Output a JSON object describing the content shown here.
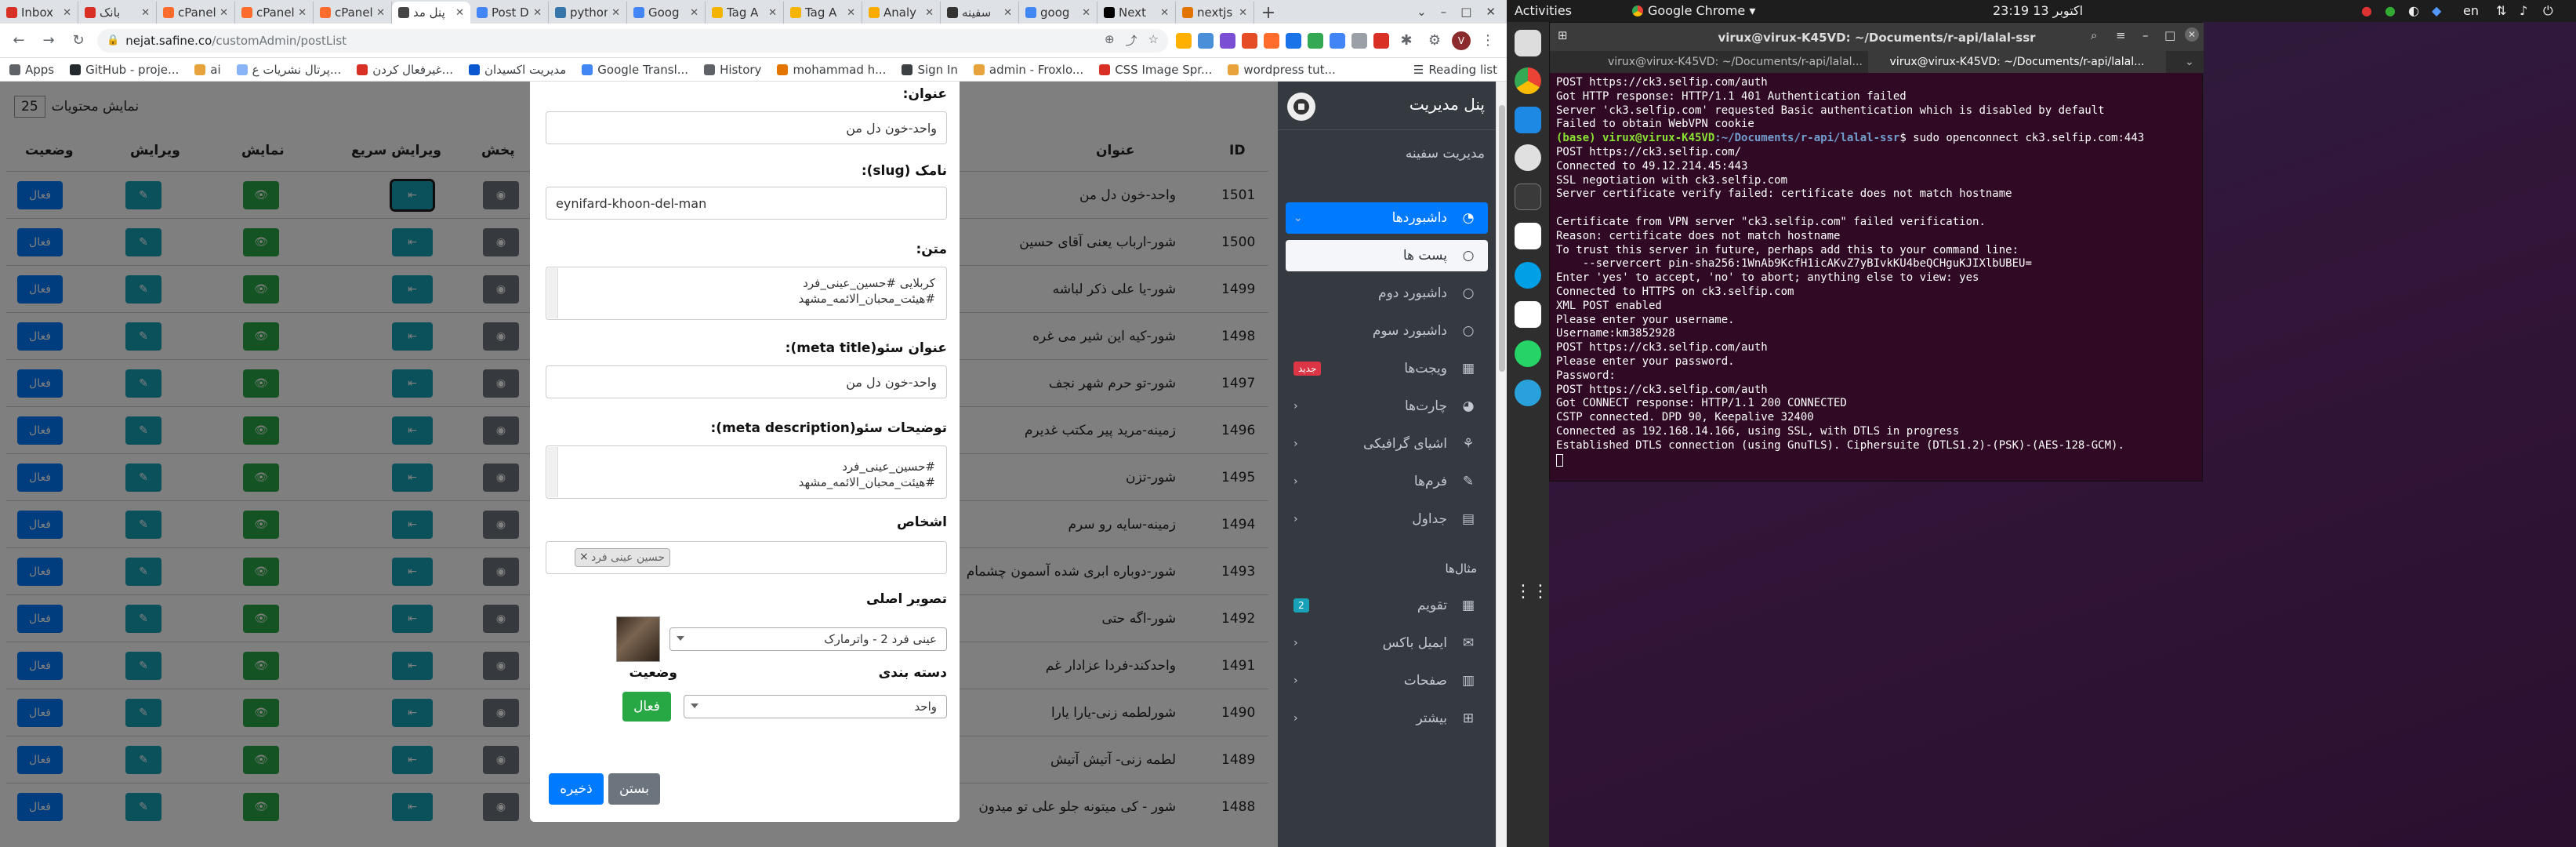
{
  "chrome": {
    "tabs": [
      {
        "label": "Inbox",
        "color": "#d93025"
      },
      {
        "label": "بانک",
        "color": "#d93025"
      },
      {
        "label": "cPanel",
        "color": "#ff6c2c"
      },
      {
        "label": "cPanel",
        "color": "#ff6c2c"
      },
      {
        "label": "cPanel",
        "color": "#ff6c2c"
      },
      {
        "label": "پنل مد",
        "color": "#444444",
        "active": true
      },
      {
        "label": "Post D",
        "color": "#4285f4"
      },
      {
        "label": "python",
        "color": "#3776ab"
      },
      {
        "label": "Goog",
        "color": "#4285f4"
      },
      {
        "label": "Tag A",
        "color": "#f4b400"
      },
      {
        "label": "Tag A",
        "color": "#f4b400"
      },
      {
        "label": "Analy",
        "color": "#f9ab00"
      },
      {
        "label": "سفینه",
        "color": "#333333"
      },
      {
        "label": "goog",
        "color": "#4285f4"
      },
      {
        "label": "Next",
        "color": "#000000"
      },
      {
        "label": "nextjs",
        "color": "#e37400"
      }
    ],
    "url_host": "nejat.safine.co",
    "url_path": "/customAdmin/postList",
    "bookmarks": [
      {
        "label": "Apps",
        "color": "#5f6368"
      },
      {
        "label": "GitHub - proje...",
        "color": "#24292e"
      },
      {
        "label": "ai",
        "color": "#e8a33d"
      },
      {
        "label": "پرتال نشریات ع...",
        "color": "#8ab4f8"
      },
      {
        "label": "غیرفعال کردن...",
        "color": "#d93025"
      },
      {
        "label": "مدیریت اکسیدان",
        "color": "#0b57d0"
      },
      {
        "label": "Google Transl...",
        "color": "#4285f4"
      },
      {
        "label": "History",
        "color": "#5f6368"
      },
      {
        "label": "mohammad h...",
        "color": "#e37400"
      },
      {
        "label": "Sign In",
        "color": "#3c4043"
      },
      {
        "label": "admin - Froxlo...",
        "color": "#e8a33d"
      },
      {
        "label": "CSS Image Spr...",
        "color": "#d93025"
      },
      {
        "label": "wordpress tut...",
        "color": "#e8a33d"
      }
    ],
    "reading_list": "Reading list"
  },
  "table": {
    "show_label": "نمایش محتویات",
    "show_count": "25",
    "headers": {
      "id": "ID",
      "title": "عنوان",
      "publish": "پخش",
      "quick_edit": "ویرایش سریع",
      "view": "نمایش",
      "edit": "ویرایش",
      "status": "وضعیت"
    },
    "status_active": "فعال",
    "rows": [
      {
        "id": "1501",
        "title": "واحد-خون دل من",
        "selected": true
      },
      {
        "id": "1500",
        "title": "شور-ارباب یعنی آقای حسین"
      },
      {
        "id": "1499",
        "title": "شور-یا علی ذکر لباشه"
      },
      {
        "id": "1498",
        "title": "شور-کیه این شیر می غره"
      },
      {
        "id": "1497",
        "title": "شور-تو حرم شهر نجف"
      },
      {
        "id": "1496",
        "title": "زمینه-مرید پیر مکتب غدیرم"
      },
      {
        "id": "1495",
        "title": "شور-تزن"
      },
      {
        "id": "1494",
        "title": "زمینه-سایه رو سرم"
      },
      {
        "id": "1493",
        "title": "شور-دوباره ابری شده آسمون چشمام"
      },
      {
        "id": "1492",
        "title": "شور-اگه حتی"
      },
      {
        "id": "1491",
        "title": "واحدکند-فردا عزادار غم"
      },
      {
        "id": "1490",
        "title": "شورلطمه زنی-یارا یارا"
      },
      {
        "id": "1489",
        "title": "لطمه زنی- آتیش آتیش"
      },
      {
        "id": "1488",
        "title": "شور - کی میتونه جلو علی تو میدون"
      }
    ]
  },
  "modal": {
    "title_label": "عنوان:",
    "title_value": "واحد-خون دل من",
    "slug_label": "نامک (slug):",
    "slug_value": "eynifard-khoon-del-man",
    "text_label": "متن:",
    "text_lines": [
      "کربلایی #حسین_عینی_فرد",
      "#هیئت_محبان_الائمه_مشهد"
    ],
    "seo_title_label": "عنوان سئو(meta title):",
    "seo_title_value": "واحد-خون دل من",
    "seo_desc_label": "توضیحات سئو(meta description):",
    "seo_desc_lines": [
      "#حسین_عینی_فرد",
      "#هیئت_محبان_الائمه_مشهد"
    ],
    "persons_label": "اشخاص",
    "person_tag": "حسین عینی فرد",
    "main_image_label": "تصویر اصلی",
    "main_image_value": "عینی فرد 2 - واترمارک",
    "category_label": "دسته بندی",
    "category_value": "واحد",
    "status_label": "وضعیت",
    "status_value": "فعال",
    "save": "ذخیره",
    "close": "بستن"
  },
  "sidebar": {
    "brand": "پنل مدیریت",
    "user": "مدیریت سفینه",
    "items": [
      {
        "label": "داشبوردها",
        "active": true,
        "chevron": true
      },
      {
        "label": "پست ها",
        "sub": true
      },
      {
        "label": "داشبورد دوم"
      },
      {
        "label": "داشبورد سوم"
      },
      {
        "label": "ویجت‌ها",
        "badge": "جدید"
      },
      {
        "label": "چارت‌ها",
        "chevron": true
      },
      {
        "label": "اشیای گرافیکی",
        "chevron": true
      },
      {
        "label": "فرم‌ها",
        "chevron": true
      },
      {
        "label": "جداول",
        "chevron": true
      }
    ],
    "section": "مثال‌ها",
    "items2": [
      {
        "label": "تقویم",
        "badge": "2"
      },
      {
        "label": "ایمیل باکس",
        "chevron": true
      },
      {
        "label": "صفحات",
        "chevron": true
      },
      {
        "label": "بیشتر",
        "chevron": true
      }
    ]
  },
  "desktop": {
    "activities": "Activities",
    "app": "Google Chrome",
    "clock": "23:19  13 اکتوبر",
    "lang": "en"
  },
  "terminal": {
    "title": "virux@virux-K45VD: ~/Documents/r-api/lalal-ssr",
    "tab1": "virux@virux-K45VD: ~/Documents/r-api/lalal...",
    "tab2": "virux@virux-K45VD: ~/Documents/r-api/lalal...",
    "lines": [
      "POST https://ck3.selfip.com/auth",
      "Got HTTP response: HTTP/1.1 401 Authentication failed",
      "Server 'ck3.selfip.com' requested Basic authentication which is disabled by default",
      "Failed to obtain WebVPN cookie",
      "PROMPT",
      "POST https://ck3.selfip.com/",
      "Connected to 49.12.214.45:443",
      "SSL negotiation with ck3.selfip.com",
      "Server certificate verify failed: certificate does not match hostname",
      "",
      "Certificate from VPN server \"ck3.selfip.com\" failed verification.",
      "Reason: certificate does not match hostname",
      "To trust this server in future, perhaps add this to your command line:",
      "    --servercert pin-sha256:1WnAb9KcfH1icAKvZ7yBIvkKU4beQCHguKJIXlbUBEU=",
      "Enter 'yes' to accept, 'no' to abort; anything else to view: yes",
      "Connected to HTTPS on ck3.selfip.com",
      "XML POST enabled",
      "Please enter your username.",
      "Username:km3852928",
      "POST https://ck3.selfip.com/auth",
      "Please enter your password.",
      "Password:",
      "POST https://ck3.selfip.com/auth",
      "Got CONNECT response: HTTP/1.1 200 CONNECTED",
      "CSTP connected. DPD 90, Keepalive 32400",
      "Connected as 192.168.14.166, using SSL, with DTLS in progress",
      "Established DTLS connection (using GnuTLS). Ciphersuite (DTLS1.2)-(PSK)-(AES-128-GCM)."
    ],
    "prompt_user": "(base) virux@virux-K45VD",
    "prompt_path": ":~/Documents/r-api/lalal-ssr",
    "prompt_cmd": "$ sudo openconnect ck3.selfip.com:443"
  }
}
